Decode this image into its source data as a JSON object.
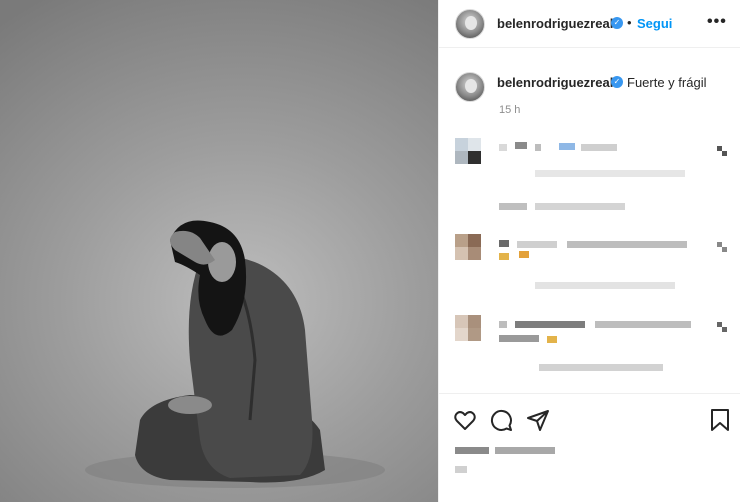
{
  "post": {
    "username": "belenrodriguezreal",
    "follow_label": "Segui",
    "separator": "•",
    "more_label": "•••",
    "caption": "Fuerte y frágil",
    "timestamp": "15 h"
  },
  "icons": {
    "verified": "verified-badge-icon",
    "like": "heart-icon",
    "comment": "comment-icon",
    "share": "paper-plane-icon",
    "save": "bookmark-icon",
    "more": "more-options-icon"
  },
  "colors": {
    "accent": "#0095f6",
    "verified": "#3897f0",
    "text": "#262626",
    "muted": "#8e8e8e"
  }
}
